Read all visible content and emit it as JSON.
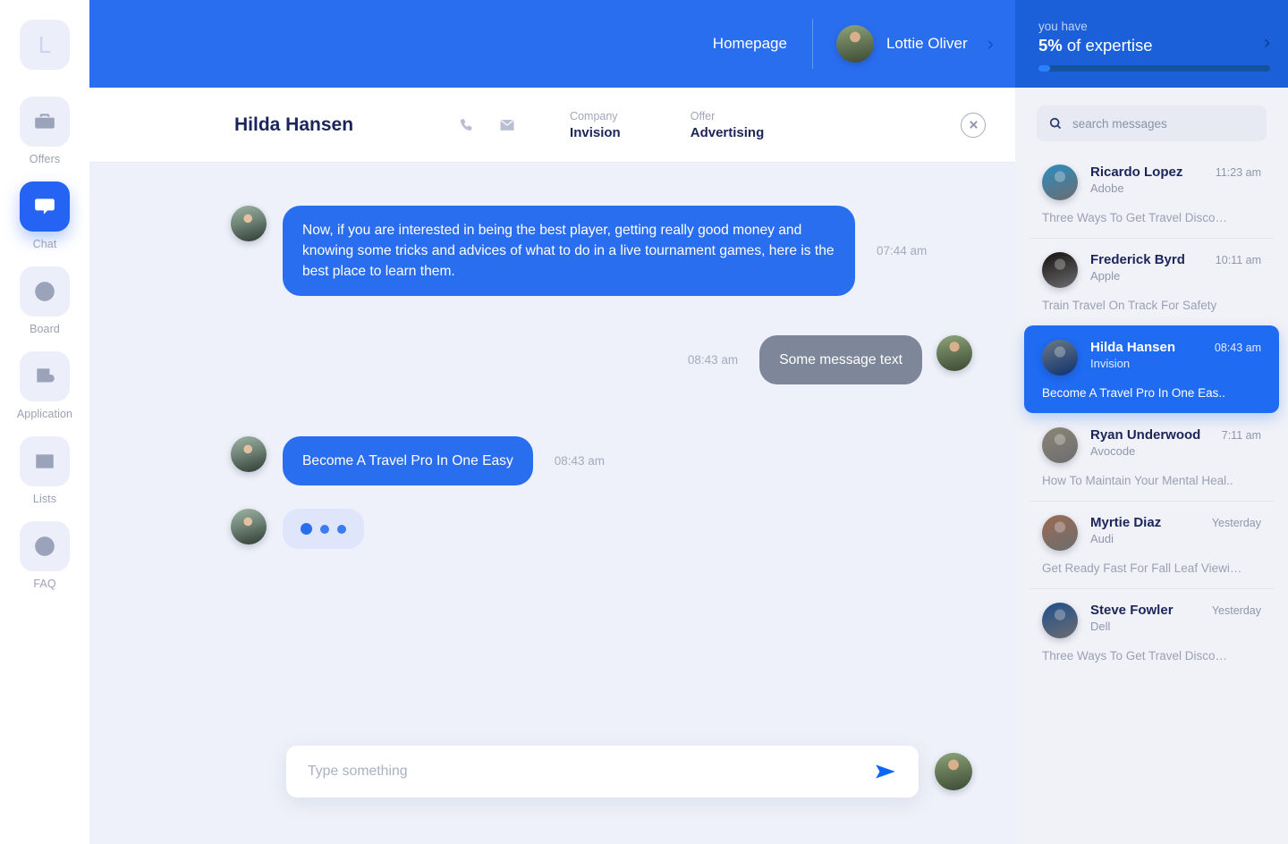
{
  "sidebar": {
    "logo_letter": "L",
    "items": [
      {
        "label": "Offers",
        "icon": "briefcase-icon",
        "active": false
      },
      {
        "label": "Chat",
        "icon": "chat-bubble-icon",
        "active": true
      },
      {
        "label": "Board",
        "icon": "sliders-icon",
        "active": false
      },
      {
        "label": "Application",
        "icon": "document-plus-icon",
        "active": false
      },
      {
        "label": "Lists",
        "icon": "contact-card-icon",
        "active": false
      },
      {
        "label": "FAQ",
        "icon": "question-mark-icon",
        "active": false
      }
    ]
  },
  "topbar": {
    "homepage_label": "Homepage",
    "user_name": "Lottie Oliver",
    "chevron": "›",
    "bg_color": "#2a6ef0"
  },
  "chat_header": {
    "contact_name": "Hilda Hansen",
    "phone_icon": "phone-icon",
    "mail_icon": "mail-icon",
    "company_label": "Company",
    "company_value": "Invision",
    "offer_label": "Offer",
    "offer_value": "Advertising",
    "close_icon": "close-circle-icon"
  },
  "messages": [
    {
      "direction": "in",
      "text": "Now, if you are interested in being the best player, getting really good money and knowing some tricks and advices of what to do in a live tournament games, here is the best place to learn them.",
      "time": "07:44 am",
      "type": "text"
    },
    {
      "direction": "out",
      "text": "Some message text",
      "time": "08:43 am",
      "type": "text"
    },
    {
      "direction": "in",
      "text": "Become A Travel Pro In One Easy",
      "time": "08:43 am",
      "type": "text"
    },
    {
      "direction": "in",
      "text": "",
      "time": "",
      "type": "typing"
    }
  ],
  "composer": {
    "placeholder": "Type something",
    "value": "",
    "send_icon": "send-arrow-icon"
  },
  "right_panel": {
    "expertise_small": "you have",
    "expertise_big_value": "5%",
    "expertise_big_rest": " of expertise",
    "expertise_percent": 5,
    "chevron": "›",
    "header_bg": "#1b60d8",
    "progress_track_color": "#14539e",
    "progress_fill_color": "#2a80ff",
    "search_placeholder": "search messages",
    "search_value": "",
    "search_icon": "search-icon",
    "conversations": [
      {
        "name": "Ricardo Lopez",
        "company": "Adobe",
        "time": "11:23 am",
        "preview": "Three Ways To Get Travel Disco…",
        "active": false,
        "avatar_color": "#2b8bbf"
      },
      {
        "name": "Frederick Byrd",
        "company": "Apple",
        "time": "10:11 am",
        "preview": "Train Travel On Track For Safety",
        "active": false,
        "avatar_color": "#14100f"
      },
      {
        "name": "Hilda Hansen",
        "company": "Invision",
        "time": "08:43 am",
        "preview": "Become A Travel Pro In One Eas..",
        "active": true,
        "avatar_color": "#6c7a84"
      },
      {
        "name": "Ryan Underwood",
        "company": "Avocode",
        "time": "7:11 am",
        "preview": "How To Maintain Your Mental Heal..",
        "active": false,
        "avatar_color": "#8b8577"
      },
      {
        "name": "Myrtie Diaz",
        "company": "Audi",
        "time": "Yesterday",
        "preview": "Get Ready Fast For Fall Leaf Viewi…",
        "active": false,
        "avatar_color": "#9a6a52"
      },
      {
        "name": "Steve Fowler",
        "company": "Dell",
        "time": "Yesterday",
        "preview": "Three Ways To Get Travel Disco…",
        "active": false,
        "avatar_color": "#1f4e8c"
      }
    ]
  },
  "colors": {
    "accent_blue": "#2a6ef0",
    "chat_bg": "#eef1f9",
    "panel_bg": "#f1f2f7",
    "out_bubble": "#7e8799",
    "typing_bubble": "#dfe6fb"
  }
}
